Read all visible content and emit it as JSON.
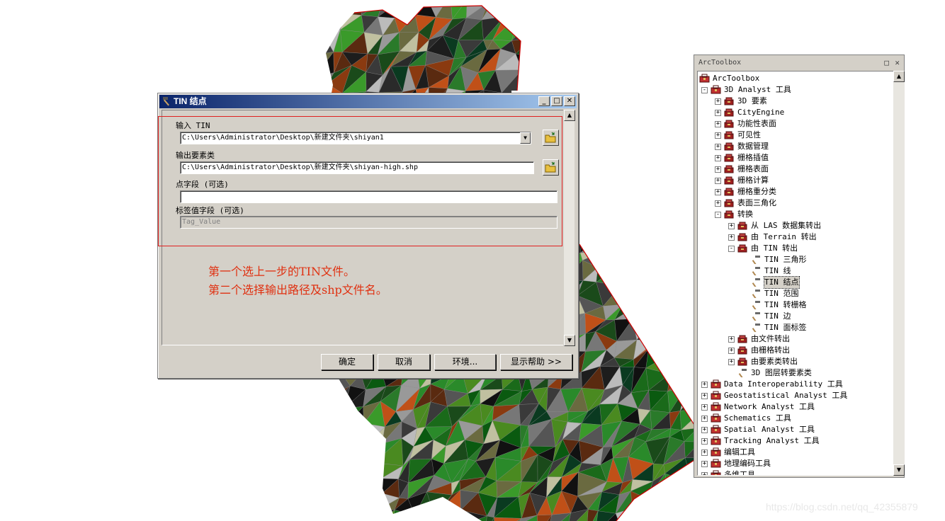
{
  "dialog": {
    "title": "TIN 结点",
    "fields": [
      {
        "label": "输入 TIN",
        "value": "C:\\Users\\Administrator\\Desktop\\新建文件夹\\shiyan1",
        "kind": "combo"
      },
      {
        "label": "输出要素类",
        "value": "C:\\Users\\Administrator\\Desktop\\新建文件夹\\shiyan-high.shp",
        "kind": "text"
      },
      {
        "label": "点字段 (可选)",
        "value": "",
        "kind": "text"
      },
      {
        "label": "标签值字段 (可选)",
        "value": "Tag_Value",
        "kind": "disabled"
      }
    ],
    "annotation": [
      "第一个选上一步的TIN文件。",
      "第二个选择输出路径及shp文件名。"
    ],
    "buttons": [
      "确定",
      "取消",
      "环境...",
      "显示帮助 >>"
    ]
  },
  "toolbox": {
    "title": "ArcToolbox",
    "items": [
      {
        "label": "ArcToolbox",
        "depth": 0,
        "toggle": "",
        "icon": "toolbox-root-icon"
      },
      {
        "label": "3D Analyst 工具",
        "depth": 0,
        "toggle": "−",
        "icon": "toolbox-icon"
      },
      {
        "label": "3D 要素",
        "depth": 1,
        "toggle": "+",
        "icon": "toolset-icon"
      },
      {
        "label": "CityEngine",
        "depth": 1,
        "toggle": "+",
        "icon": "toolset-icon"
      },
      {
        "label": "功能性表面",
        "depth": 1,
        "toggle": "+",
        "icon": "toolset-icon"
      },
      {
        "label": "可见性",
        "depth": 1,
        "toggle": "+",
        "icon": "toolset-icon"
      },
      {
        "label": "数据管理",
        "depth": 1,
        "toggle": "+",
        "icon": "toolset-icon"
      },
      {
        "label": "栅格插值",
        "depth": 1,
        "toggle": "+",
        "icon": "toolset-icon"
      },
      {
        "label": "栅格表面",
        "depth": 1,
        "toggle": "+",
        "icon": "toolset-icon"
      },
      {
        "label": "栅格计算",
        "depth": 1,
        "toggle": "+",
        "icon": "toolset-icon"
      },
      {
        "label": "栅格重分类",
        "depth": 1,
        "toggle": "+",
        "icon": "toolset-icon"
      },
      {
        "label": "表面三角化",
        "depth": 1,
        "toggle": "+",
        "icon": "toolset-icon"
      },
      {
        "label": "转换",
        "depth": 1,
        "toggle": "−",
        "icon": "toolset-icon"
      },
      {
        "label": "从 LAS 数据集转出",
        "depth": 2,
        "toggle": "+",
        "icon": "toolset-icon"
      },
      {
        "label": "由 Terrain 转出",
        "depth": 2,
        "toggle": "+",
        "icon": "toolset-icon"
      },
      {
        "label": "由 TIN 转出",
        "depth": 2,
        "toggle": "−",
        "icon": "toolset-icon"
      },
      {
        "label": "TIN 三角形",
        "depth": 3,
        "toggle": "",
        "icon": "hammer-icon"
      },
      {
        "label": "TIN 线",
        "depth": 3,
        "toggle": "",
        "icon": "hammer-icon"
      },
      {
        "label": "TIN 结点",
        "depth": 3,
        "toggle": "",
        "icon": "hammer-icon",
        "selected": true
      },
      {
        "label": "TIN 范围",
        "depth": 3,
        "toggle": "",
        "icon": "hammer-icon"
      },
      {
        "label": "TIN 转栅格",
        "depth": 3,
        "toggle": "",
        "icon": "hammer-icon"
      },
      {
        "label": "TIN 边",
        "depth": 3,
        "toggle": "",
        "icon": "hammer-icon"
      },
      {
        "label": "TIN 面标签",
        "depth": 3,
        "toggle": "",
        "icon": "hammer-icon"
      },
      {
        "label": "由文件转出",
        "depth": 2,
        "toggle": "+",
        "icon": "toolset-icon"
      },
      {
        "label": "由栅格转出",
        "depth": 2,
        "toggle": "+",
        "icon": "toolset-icon"
      },
      {
        "label": "由要素类转出",
        "depth": 2,
        "toggle": "+",
        "icon": "toolset-icon"
      },
      {
        "label": "3D 图层转要素类",
        "depth": 2,
        "toggle": "",
        "icon": "hammer-icon"
      },
      {
        "label": "Data Interoperability 工具",
        "depth": 0,
        "toggle": "+",
        "icon": "toolbox-icon"
      },
      {
        "label": "Geostatistical Analyst 工具",
        "depth": 0,
        "toggle": "+",
        "icon": "toolbox-icon"
      },
      {
        "label": "Network Analyst 工具",
        "depth": 0,
        "toggle": "+",
        "icon": "toolbox-icon"
      },
      {
        "label": "Schematics 工具",
        "depth": 0,
        "toggle": "+",
        "icon": "toolbox-icon"
      },
      {
        "label": "Spatial Analyst 工具",
        "depth": 0,
        "toggle": "+",
        "icon": "toolbox-icon"
      },
      {
        "label": "Tracking Analyst 工具",
        "depth": 0,
        "toggle": "+",
        "icon": "toolbox-icon"
      },
      {
        "label": "编辑工具",
        "depth": 0,
        "toggle": "+",
        "icon": "toolbox-icon"
      },
      {
        "label": "地理编码工具",
        "depth": 0,
        "toggle": "+",
        "icon": "toolbox-icon"
      },
      {
        "label": "多维工具",
        "depth": 0,
        "toggle": "+",
        "icon": "toolbox-icon"
      }
    ]
  },
  "watermark": "https://blog.csdn.net/qq_42355879",
  "colors": {
    "annotation": "#e03010",
    "title_bar": "#0a246a",
    "tin_outline": "#cc0000"
  }
}
